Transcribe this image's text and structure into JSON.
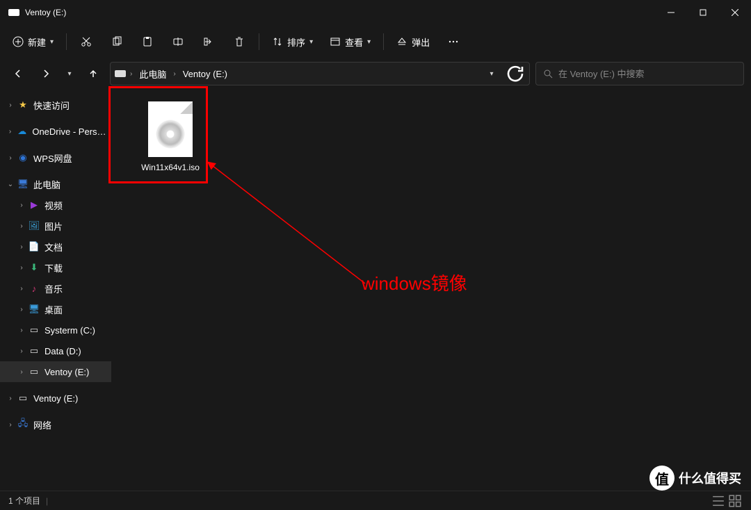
{
  "window": {
    "title": "Ventoy (E:)"
  },
  "toolbar": {
    "new_label": "新建",
    "sort_label": "排序",
    "view_label": "查看",
    "eject_label": "弹出"
  },
  "breadcrumb": {
    "root": "此电脑",
    "current": "Ventoy (E:)"
  },
  "search": {
    "placeholder": "在 Ventoy (E:) 中搜索"
  },
  "sidebar": {
    "quick_access": "快速访问",
    "onedrive": "OneDrive - Persona",
    "wps": "WPS网盘",
    "this_pc": "此电脑",
    "videos": "视频",
    "pictures": "图片",
    "documents": "文档",
    "downloads": "下载",
    "music": "音乐",
    "desktop": "桌面",
    "drive_c": "Systerm (C:)",
    "drive_d": "Data (D:)",
    "drive_e": "Ventoy (E:)",
    "drive_e2": "Ventoy (E:)",
    "network": "网络"
  },
  "files": {
    "iso": {
      "name": "Win11x64v1.iso"
    }
  },
  "annotation": {
    "text": "windows镜像"
  },
  "status": {
    "count": "1 个项目"
  },
  "watermark": {
    "text": "什么值得买",
    "badge": "值"
  }
}
